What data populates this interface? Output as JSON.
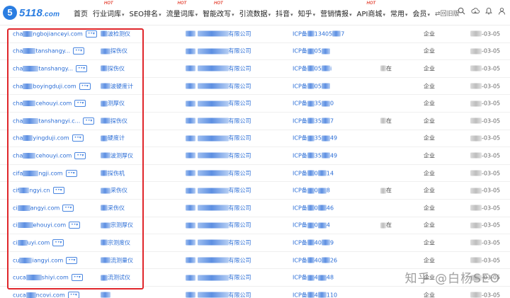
{
  "brand": {
    "mark": "5",
    "name": "5118",
    "suffix": ".com"
  },
  "nav": [
    {
      "label": "首页",
      "caret": false,
      "hot": ""
    },
    {
      "label": "行业词库",
      "caret": true,
      "hot": "HOT"
    },
    {
      "label": "SEO排名",
      "caret": true,
      "hot": ""
    },
    {
      "label": "流量词库",
      "caret": true,
      "hot": "HOT"
    },
    {
      "label": "智能改写",
      "caret": true,
      "hot": "HOT"
    },
    {
      "label": "引流数据",
      "caret": true,
      "hot": ""
    },
    {
      "label": "抖音",
      "caret": true,
      "hot": ""
    },
    {
      "label": "知乎",
      "caret": true,
      "hot": ""
    },
    {
      "label": "营销情报",
      "caret": true,
      "hot": ""
    },
    {
      "label": "API商城",
      "caret": true,
      "hot": "HOT"
    },
    {
      "label": "常用",
      "caret": true,
      "hot": ""
    },
    {
      "label": "会员",
      "caret": true,
      "hot": ""
    },
    {
      "label": "⇄回旧版",
      "caret": false,
      "hot": "",
      "cls": "oldver"
    }
  ],
  "header_icons": [
    "search-icon",
    "cloud-download-icon",
    "bell-icon",
    "user-icon"
  ],
  "rows": [
    {
      "domain_pre": "cha",
      "domain_suf": "ngbojianceyi.com",
      "tag": "••▾",
      "name": "波检测仪",
      "company": "有限公司",
      "icp_pre": "ICP备",
      "icp_suf": "13405",
      "icp_end": "7",
      "extra": "",
      "type": "企业",
      "date": "-03-05"
    },
    {
      "domain_pre": "cha",
      "domain_suf": "tanshangy...",
      "tag": "••▾",
      "name": "探伤仪",
      "company": "有限公司",
      "icp_pre": "ICP备",
      "icp_suf": "05",
      "icp_end": "",
      "extra": "",
      "type": "企业",
      "date": "-03-05"
    },
    {
      "domain_pre": "cha",
      "domain_suf": "tanshangy...",
      "tag": "••▾",
      "name": "探伤仪",
      "company": "有限公司",
      "icp_pre": "ICP备",
      "icp_suf": "05",
      "icp_end": "i",
      "extra": "在",
      "type": "企业",
      "date": "-03-05"
    },
    {
      "domain_pre": "cha",
      "domain_suf": "boyingduji.com",
      "tag": "••▾",
      "name": "波硬度计",
      "company": "有限公司",
      "icp_pre": "ICP备",
      "icp_suf": "05",
      "icp_end": "",
      "extra": "",
      "type": "企业",
      "date": "-03-05"
    },
    {
      "domain_pre": "cha",
      "domain_suf": "cehouyi.com",
      "tag": "••▾",
      "name": "测厚仪",
      "company": "有限公司",
      "icp_pre": "ICP备",
      "icp_suf": "35",
      "icp_end": "0",
      "extra": "",
      "type": "企业",
      "date": "-03-05"
    },
    {
      "domain_pre": "cha",
      "domain_suf": "tanshangyi.c...",
      "tag": "••▾",
      "name": "探伤仪",
      "company": "有限公司",
      "icp_pre": "ICP备",
      "icp_suf": "35",
      "icp_end": "7",
      "extra": "在",
      "type": "企业",
      "date": "-03-05"
    },
    {
      "domain_pre": "cha",
      "domain_suf": "yingduji.com",
      "tag": "••▾",
      "name": "硬度计",
      "company": "有限公司",
      "icp_pre": "ICP备",
      "icp_suf": "35",
      "icp_end": "49",
      "extra": "",
      "type": "企业",
      "date": "-03-05"
    },
    {
      "domain_pre": "cha",
      "domain_suf": "cehouyi.com",
      "tag": "••▾",
      "name": "波测厚仪",
      "company": "有限公司",
      "icp_pre": "ICP备",
      "icp_suf": "35",
      "icp_end": "49",
      "extra": "",
      "type": "企业",
      "date": "-03-05"
    },
    {
      "domain_pre": "cifa",
      "domain_suf": "ngji.com",
      "tag": "••▾",
      "name": "探伤机",
      "company": "有限公司",
      "icp_pre": "ICP备",
      "icp_suf": "0",
      "icp_end": "14",
      "extra": "",
      "type": "企业",
      "date": "-03-05"
    },
    {
      "domain_pre": "cif",
      "domain_suf": "ngyi.cn",
      "tag": "••▾",
      "name": "采伤仪",
      "company": "有限公司",
      "icp_pre": "ICP备",
      "icp_suf": "0",
      "icp_end": "8",
      "extra": "在",
      "type": "企业",
      "date": "-03-05"
    },
    {
      "domain_pre": "ci",
      "domain_suf": "angyi.com",
      "tag": "••▾",
      "name": "采伤仪",
      "company": "有限公司",
      "icp_pre": "ICP备",
      "icp_suf": "0",
      "icp_end": "46",
      "extra": "",
      "type": "企业",
      "date": "-03-05"
    },
    {
      "domain_pre": "ci",
      "domain_suf": "ehouyi.com",
      "tag": "••▾",
      "name": "宗测厚仪",
      "company": "有限公司",
      "icp_pre": "ICP备",
      "icp_suf": "0",
      "icp_end": "4",
      "extra": "在",
      "type": "企业",
      "date": "-03-05"
    },
    {
      "domain_pre": "ci",
      "domain_suf": "uyi.com",
      "tag": "••▾",
      "name": "宗测度仪",
      "company": "有限公司",
      "icp_pre": "ICP备",
      "icp_suf": "40",
      "icp_end": "9",
      "extra": "",
      "type": "企业",
      "date": "-03-05"
    },
    {
      "domain_pre": "cu",
      "domain_suf": "iangyi.com",
      "tag": "••▾",
      "name": "流测量仪",
      "company": "有限公司",
      "icp_pre": "ICP备",
      "icp_suf": "40",
      "icp_end": "26",
      "extra": "",
      "type": "企业",
      "date": "-03-05"
    },
    {
      "domain_pre": "cuca",
      "domain_suf": "shiyi.com",
      "tag": "••▾",
      "name": "流测试仪",
      "company": "有限公司",
      "icp_pre": "ICP备",
      "icp_suf": "4",
      "icp_end": "48",
      "extra": "",
      "type": "企业",
      "date": "-03-05"
    },
    {
      "domain_pre": "cuca",
      "domain_suf": "ncovi.com",
      "tag": "••▾",
      "name": "",
      "company": "有限公司",
      "icp_pre": "ICP备",
      "icp_suf": "4",
      "icp_end": "110",
      "extra": "",
      "type": "企业",
      "date": "-03-05"
    }
  ],
  "watermark": "知乎 @白杨SEO"
}
